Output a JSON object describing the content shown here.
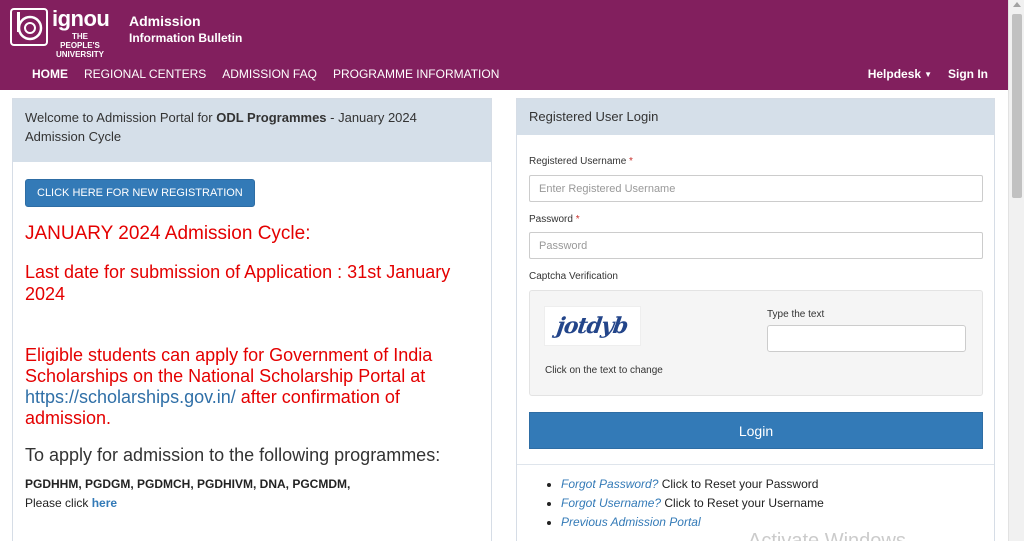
{
  "logo": {
    "name": "ignou",
    "tagline_1": "THE PEOPLE'S",
    "tagline_2": "UNIVERSITY"
  },
  "site": {
    "title": "Admission",
    "subtitle": "Information Bulletin"
  },
  "nav": {
    "items": [
      "HOME",
      "REGIONAL CENTERS",
      "ADMISSION FAQ",
      "PROGRAMME INFORMATION"
    ],
    "helpdesk": "Helpdesk",
    "signin": "Sign In"
  },
  "left": {
    "welcome_prefix": "Welcome to Admission Portal for ",
    "welcome_bold": "ODL Programmes",
    "welcome_suffix": " - January 2024 Admission Cycle",
    "register_button": "CLICK HERE FOR NEW REGISTRATION",
    "cycle_heading": "JANUARY 2024 Admission Cycle:",
    "last_date": "Last date for submission of Application : 31st January 2024",
    "scholarship_prefix": "Eligible students can apply for Government of India Scholarships on the National Scholarship Portal at ",
    "scholarship_link": "https://scholarships.gov.in/",
    "scholarship_suffix": " after confirmation of admission.",
    "apply_heading": "To apply for admission to the following programmes:",
    "programmes": "PGDHHM, PGDGM, PGDMCH, PGDHIVM, DNA, PGCMDM,",
    "please_click": "Please click ",
    "here_link": "here"
  },
  "login": {
    "heading": "Registered User Login",
    "username_label": "Registered Username",
    "username_placeholder": "Enter Registered Username",
    "password_label": "Password",
    "password_placeholder": "Password",
    "required_mark": "*",
    "captcha_label": "Captcha Verification",
    "captcha_text": "jotdyb",
    "captcha_hint": "Click on the text to change",
    "type_text_label": "Type the text",
    "login_button": "Login",
    "forgot_password_link": "Forgot Password?",
    "forgot_password_text": " Click to Reset your Password",
    "forgot_username_link": "Forgot Username?",
    "forgot_username_text": " Click to Reset your Username",
    "previous_portal_link": "Previous Admission Portal"
  },
  "watermark": "Activate Windows",
  "colors": {
    "header": "#821f5e",
    "button": "#337ab7",
    "alert_red": "#e40000",
    "panel_head": "#d5dfe9"
  }
}
